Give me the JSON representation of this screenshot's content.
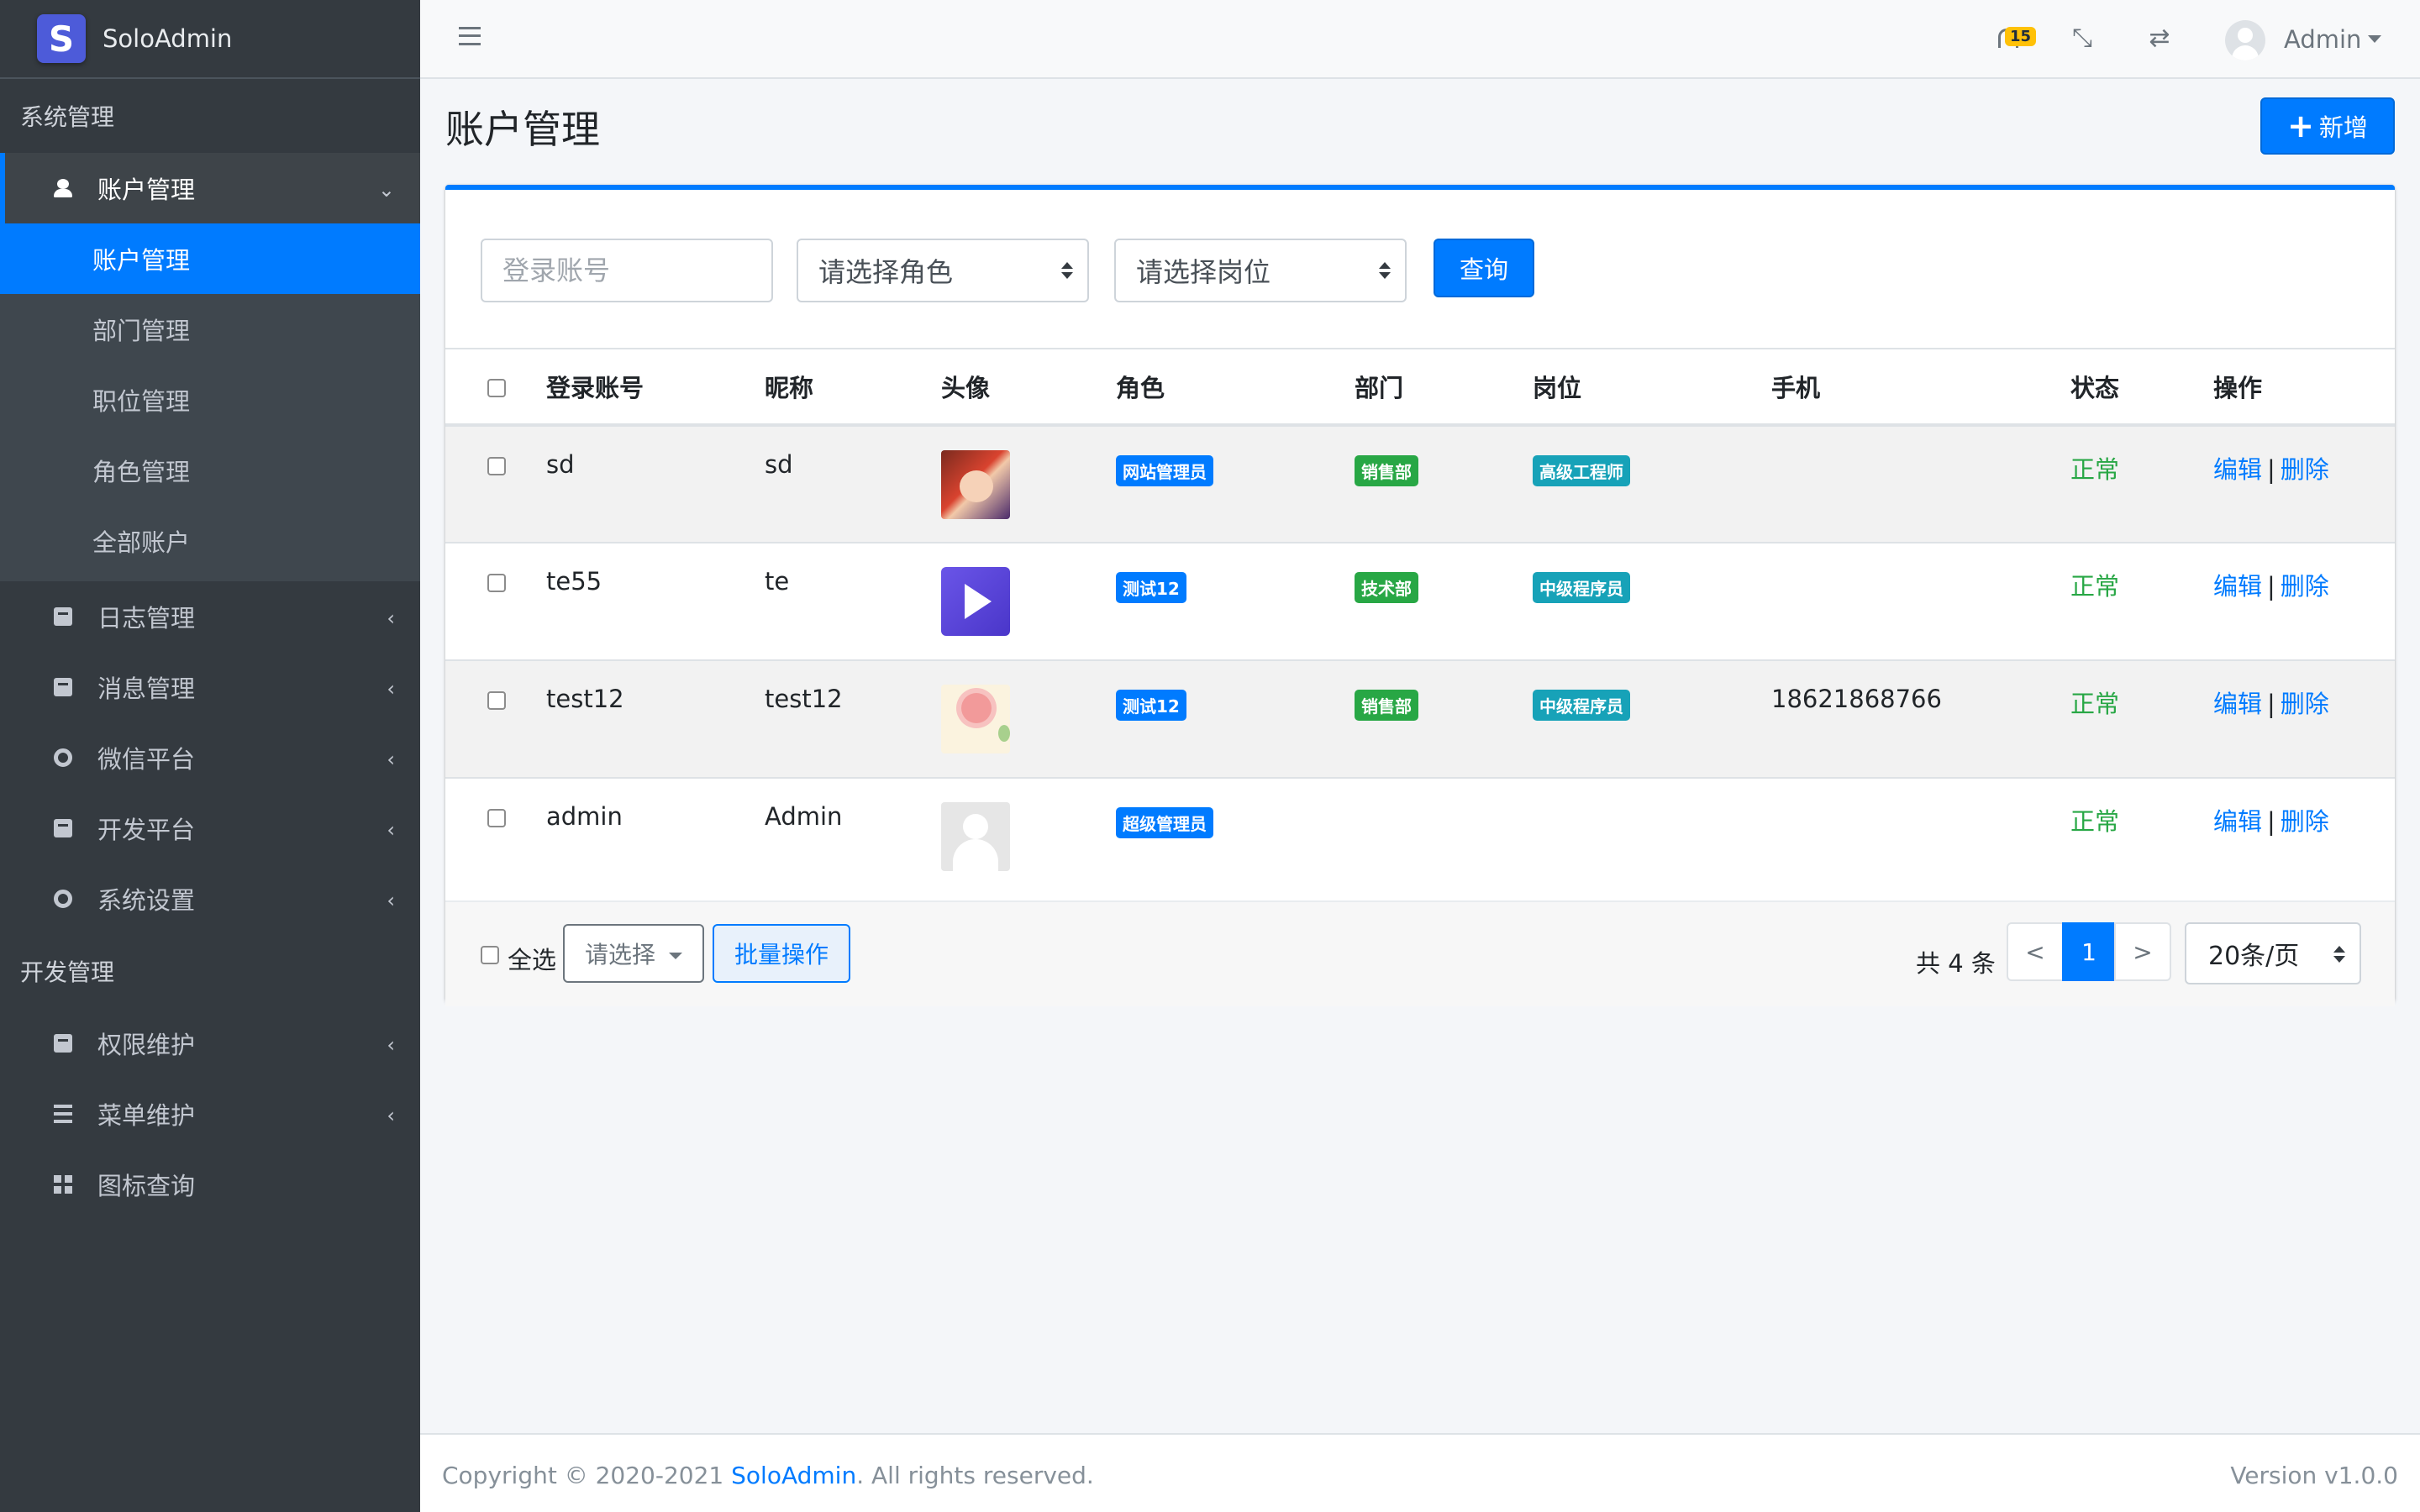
{
  "brand": {
    "name": "SoloAdmin",
    "logo_letter": "S"
  },
  "sidebar": {
    "section1": "系统管理",
    "account": {
      "label": "账户管理",
      "arrow": "⌄"
    },
    "sub": [
      "账户管理",
      "部门管理",
      "职位管理",
      "角色管理",
      "全部账户"
    ],
    "items": [
      {
        "label": "日志管理",
        "arrow": "‹"
      },
      {
        "label": "消息管理",
        "arrow": "‹"
      },
      {
        "label": "微信平台",
        "arrow": "‹"
      },
      {
        "label": "开发平台",
        "arrow": "‹"
      },
      {
        "label": "系统设置",
        "arrow": "‹"
      }
    ],
    "section2": "开发管理",
    "dev_items": [
      {
        "label": "权限维护",
        "arrow": "‹"
      },
      {
        "label": "菜单维护",
        "arrow": "‹"
      },
      {
        "label": "图标查询"
      }
    ]
  },
  "topbar": {
    "notification_count": "15",
    "compress_glyph": "⤡",
    "swap_glyph": "⇄",
    "user": "Admin"
  },
  "page": {
    "title": "账户管理",
    "add_plus": "+",
    "add_label": "新增"
  },
  "filter": {
    "account_placeholder": "登录账号",
    "role_select": "请选择角色",
    "post_select": "请选择岗位",
    "query_label": "查询"
  },
  "table": {
    "headers": [
      "登录账号",
      "昵称",
      "头像",
      "角色",
      "部门",
      "岗位",
      "手机",
      "状态",
      "操作"
    ],
    "rows": [
      {
        "account": "sd",
        "nickname": "sd",
        "role": "网站管理员",
        "dept": "销售部",
        "post": "高级工程师",
        "phone": "",
        "status": "正常"
      },
      {
        "account": "te55",
        "nickname": "te",
        "role": "测试12",
        "dept": "技术部",
        "post": "中级程序员",
        "phone": "",
        "status": "正常"
      },
      {
        "account": "test12",
        "nickname": "test12",
        "role": "测试12",
        "dept": "销售部",
        "post": "中级程序员",
        "phone": "18621868766",
        "status": "正常"
      },
      {
        "account": "admin",
        "nickname": "Admin",
        "role": "超级管理员",
        "dept": "",
        "post": "",
        "phone": "",
        "status": "正常"
      }
    ],
    "edit_label": "编辑",
    "sep": "|",
    "delete_label": "删除"
  },
  "footer_bar": {
    "select_all": "全选",
    "select_placeholder": "请选择",
    "batch_label": "批量操作",
    "total": "共 4 条",
    "prev": "<",
    "page": "1",
    "next": ">",
    "page_size": "20条/页"
  },
  "footer": {
    "copyright_prefix": "Copyright © 2020-2021 ",
    "link": "SoloAdmin",
    "copyright_suffix": ". All rights reserved.",
    "version": "Version v1.0.0"
  },
  "colors": {
    "primary": "#007bff",
    "sidebar": "#343a40",
    "success": "#28a745",
    "info": "#17a2b8",
    "warning": "#ffc107"
  }
}
